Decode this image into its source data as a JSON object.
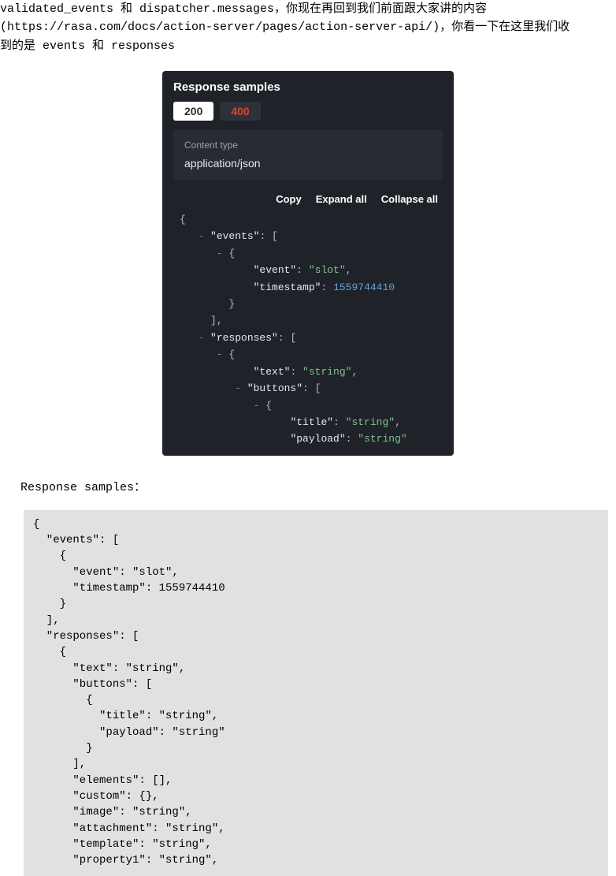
{
  "intro": {
    "line1_pre": "validated_events 和 dispatcher.messages，你现在再回到我们前面跟大家讲的内容",
    "line2_pre": "(",
    "url": "https://rasa.com/docs/action-server/pages/action-server-api/",
    "line2_post": ")，你看一下在这里我们收",
    "line3": "到的是 events 和 responses"
  },
  "panel": {
    "title": "Response samples",
    "tab200": "200",
    "tab400": "400",
    "ctLabel": "Content type",
    "ctValue": "application/json",
    "actions": {
      "copy": "Copy",
      "expand": "Expand all",
      "collapse": "Collapse all"
    },
    "json": {
      "brace_open": "{",
      "events_key": "\"events\"",
      "events_open": ": [",
      "obj_open": "{",
      "event_k": "\"event\"",
      "event_v": "\"slot\"",
      "ts_k": "\"timestamp\"",
      "ts_v": "1559744410",
      "obj_close": "}",
      "arr_close": "],",
      "responses_key": "\"responses\"",
      "responses_open": ": [",
      "text_k": "\"text\"",
      "text_v": "\"string\"",
      "buttons_k": "\"buttons\"",
      "buttons_open": ": [",
      "title_k": "\"title\"",
      "title_v": "\"string\"",
      "payload_k": "\"payload\"",
      "payload_v": "\"string\"",
      "comma": ",",
      "colon": ": ",
      "dash": "- "
    }
  },
  "rsHeading": "Response samples：",
  "codeBlock": "{\n  \"events\": [\n    {\n      \"event\": \"slot\",\n      \"timestamp\": 1559744410\n    }\n  ],\n  \"responses\": [\n    {\n      \"text\": \"string\",\n      \"buttons\": [\n        {\n          \"title\": \"string\",\n          \"payload\": \"string\"\n        }\n      ],\n      \"elements\": [],\n      \"custom\": {},\n      \"image\": \"string\",\n      \"attachment\": \"string\",\n      \"template\": \"string\",\n      \"property1\": \"string\","
}
